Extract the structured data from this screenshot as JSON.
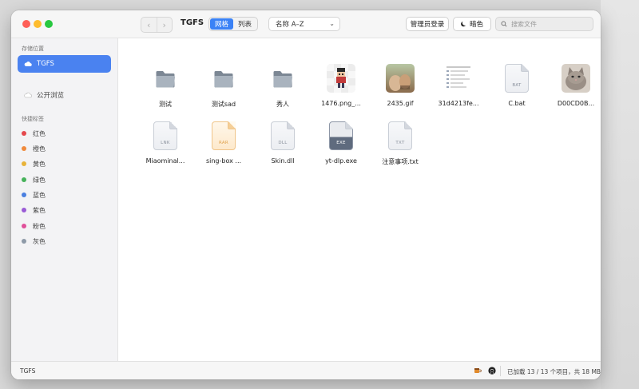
{
  "toolbar": {
    "title": "TGFS",
    "view_grid": "网格",
    "view_list": "列表",
    "sort_value": "名称 A–Z",
    "admin_login": "管理员登录",
    "theme_label": "暗色",
    "search_placeholder": "搜索文件"
  },
  "sidebar": {
    "storage_title": "存储位置",
    "locations": [
      {
        "label": "TGFS",
        "icon": "cloud-icon",
        "active": true
      },
      {
        "label": "公开浏览",
        "icon": "cloud-outline-icon",
        "active": false
      }
    ],
    "tags_title": "快捷标签",
    "tags": [
      {
        "label": "红色",
        "color": "#e5484d"
      },
      {
        "label": "橙色",
        "color": "#f08a3c"
      },
      {
        "label": "黄色",
        "color": "#e8b33a"
      },
      {
        "label": "绿色",
        "color": "#46b25a"
      },
      {
        "label": "蓝色",
        "color": "#4a7fe0"
      },
      {
        "label": "紫色",
        "color": "#9a5bd6"
      },
      {
        "label": "粉色",
        "color": "#e0509a"
      },
      {
        "label": "灰色",
        "color": "#8e9aa8"
      }
    ]
  },
  "files": [
    {
      "name": "测试",
      "kind": "folder"
    },
    {
      "name": "测试sad",
      "kind": "folder"
    },
    {
      "name": "秀人",
      "kind": "folder"
    },
    {
      "name": "1476.png_...",
      "kind": "image-pixel"
    },
    {
      "name": "2435.gif",
      "kind": "image-photo"
    },
    {
      "name": "31d4213fe...",
      "kind": "image-doc"
    },
    {
      "name": "C.bat",
      "kind": "doc",
      "ext": "BAT"
    },
    {
      "name": "D00CD0B...",
      "kind": "image-cat"
    },
    {
      "name": "Miaominal...",
      "kind": "doc",
      "ext": "LNK"
    },
    {
      "name": "sing-box ...",
      "kind": "doc-orange",
      "ext": "RAR"
    },
    {
      "name": "Skin.dll",
      "kind": "doc",
      "ext": "DLL"
    },
    {
      "name": "yt-dlp.exe",
      "kind": "doc-dark",
      "ext": "EXE"
    },
    {
      "name": "注意事项.txt",
      "kind": "doc",
      "ext": "TXT"
    }
  ],
  "statusbar": {
    "location": "TGFS",
    "summary": "已加载 13 / 13 个项目，共 18 MB"
  }
}
